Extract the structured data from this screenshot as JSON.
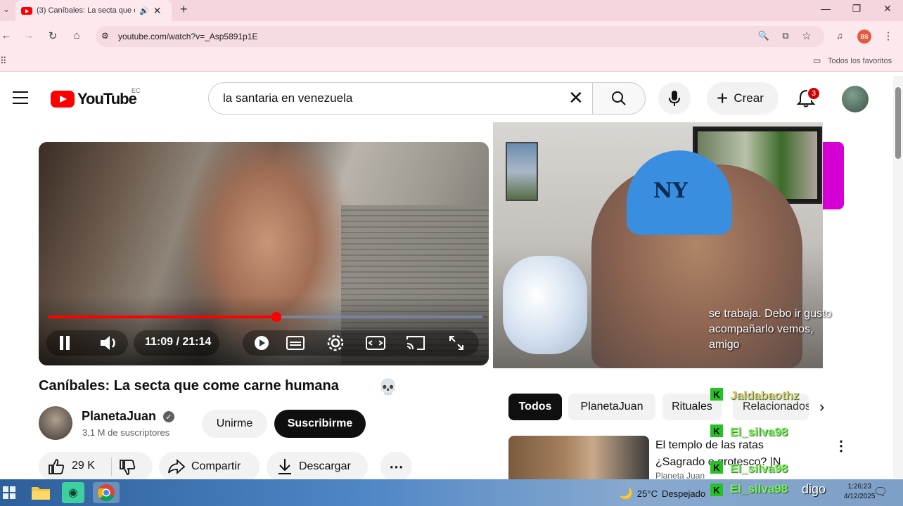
{
  "browser": {
    "tab_title": "(3) Caníbales: La secta que c",
    "url": "youtube.com/watch?v=_Asp5891p1E",
    "bookmarks_label": "Todos los favoritos",
    "profile_initials": "BS"
  },
  "youtube": {
    "logo_text": "YouTube",
    "region": "EC",
    "search_value": "la santaria en venezuela",
    "create_label": "Crear",
    "notification_count": "3"
  },
  "player": {
    "current_time": "11:09 / 21:14",
    "progress_fraction": 0.526
  },
  "webcam_chat": {
    "text": "se trabaja. Debo ir gusto acompañarlo vemos, amigo"
  },
  "video": {
    "title": "Caníbales: La secta que come carne humana",
    "title_emoji": "💀",
    "channel_name": "PlanetaJuan",
    "subscribers": "3,1 M de suscriptores",
    "join_label": "Unirme",
    "subscribe_label": "Suscribirme",
    "likes": "29 K",
    "share_label": "Compartir",
    "download_label": "Descargar"
  },
  "related": {
    "chips": [
      "Todos",
      "PlanetaJuan",
      "Rituales",
      "Relacionados"
    ],
    "item_title": "El templo de las ratas ¿Sagrado o grotesco? |N",
    "item_channel": "Planeta Juan"
  },
  "chat_overlay": {
    "names": [
      "Jaldabaothz",
      "El_silva98",
      "El_silva98"
    ],
    "last_name": "El_silva98",
    "last_message": "digo"
  },
  "taskbar": {
    "weather_temp": "25°C",
    "weather_desc": "Despejado",
    "time": "1:26:23",
    "date": "4/12/2025"
  },
  "colors": {
    "accent_red": "#ff0000",
    "chat_green": "#7cf060"
  }
}
